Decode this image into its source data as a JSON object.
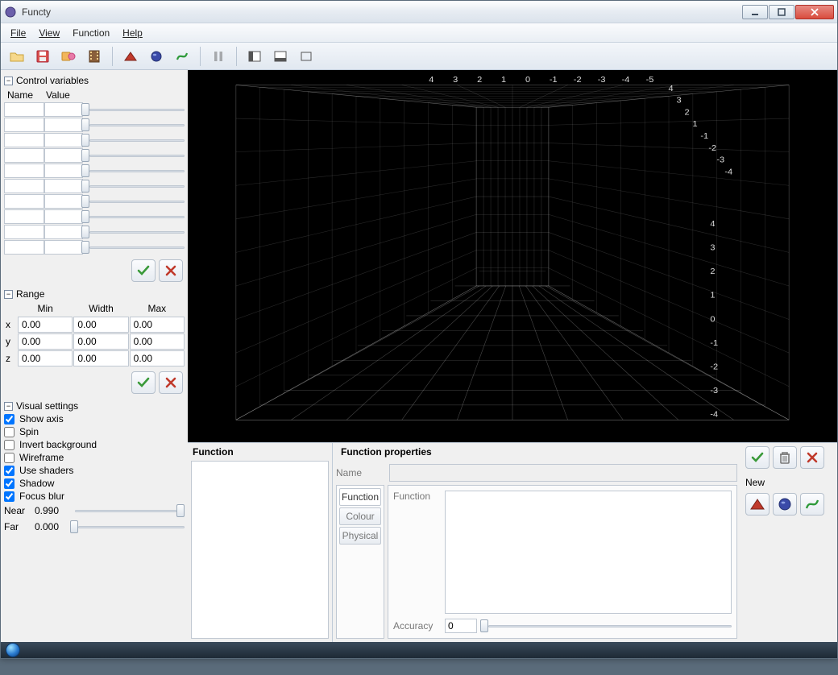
{
  "window": {
    "title": "Functy"
  },
  "menu": {
    "file": "File",
    "view": "View",
    "function": "Function",
    "help": "Help"
  },
  "sidebar": {
    "control_vars": {
      "title": "Control variables",
      "col_name": "Name",
      "col_value": "Value",
      "rows": 10
    },
    "range": {
      "title": "Range",
      "headers": {
        "min": "Min",
        "width": "Width",
        "max": "Max"
      },
      "rows": [
        {
          "label": "x",
          "min": "0.00",
          "width": "0.00",
          "max": "0.00"
        },
        {
          "label": "y",
          "min": "0.00",
          "width": "0.00",
          "max": "0.00"
        },
        {
          "label": "z",
          "min": "0.00",
          "width": "0.00",
          "max": "0.00"
        }
      ]
    },
    "visual": {
      "title": "Visual settings",
      "items": [
        {
          "label": "Show axis",
          "checked": true
        },
        {
          "label": "Spin",
          "checked": false
        },
        {
          "label": "Invert background",
          "checked": false
        },
        {
          "label": "Wireframe",
          "checked": false
        },
        {
          "label": "Use shaders",
          "checked": true
        },
        {
          "label": "Shadow",
          "checked": true
        },
        {
          "label": "Focus blur",
          "checked": true
        }
      ],
      "near_label": "Near",
      "near_value": "0.990",
      "far_label": "Far",
      "far_value": "0.000"
    }
  },
  "viewport": {
    "top_ticks": [
      "4",
      "3",
      "2",
      "1",
      "0",
      "-1",
      "-2",
      "-3",
      "-4",
      "-5"
    ],
    "right_upper_ticks": [
      "4",
      "3",
      "2",
      "1",
      "-1",
      "-2",
      "-3",
      "-4"
    ],
    "right_lower_ticks": [
      "4",
      "3",
      "2",
      "1",
      "0",
      "-1",
      "-2",
      "-3",
      "-4"
    ]
  },
  "bottom": {
    "func_list_title": "Function",
    "props_title": "Function properties",
    "name_label": "Name",
    "tabs": {
      "function": "Function",
      "colour": "Colour",
      "physical": "Physical"
    },
    "function_label": "Function",
    "accuracy_label": "Accuracy",
    "accuracy_value": "0",
    "new_label": "New"
  }
}
